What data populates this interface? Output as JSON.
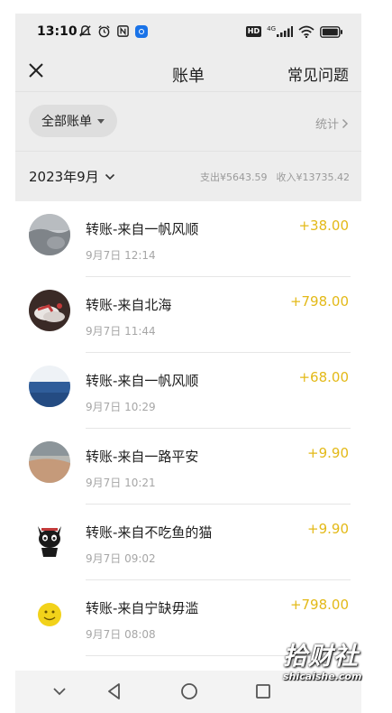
{
  "status_bar": {
    "time": "13:10",
    "left_icons": [
      "mute-icon",
      "alarm-icon",
      "nfc-icon",
      "app-notification-icon"
    ],
    "right_icons": [
      "hd-icon",
      "signal-icon",
      "wifi-icon",
      "battery-icon"
    ],
    "hd_label": "HD",
    "network_label": "4G"
  },
  "nav": {
    "title": "账单",
    "faq_label": "常见问题",
    "close_icon": "close-icon"
  },
  "filter": {
    "all_bills_label": "全部账单",
    "stats_label": "统计"
  },
  "month": {
    "label": "2023年9月",
    "expense": "支出¥5643.59",
    "income": "收入¥13735.42"
  },
  "transactions": [
    {
      "title": "转账-来自一帆风顺",
      "time": "9月7日 12:14",
      "amount": "+38.00",
      "avatar": "gray-landscape"
    },
    {
      "title": "转账-来自北海",
      "time": "9月7日 11:44",
      "amount": "+798.00",
      "avatar": "shoes-photo"
    },
    {
      "title": "转账-来自一帆风顺",
      "time": "9月7日 10:29",
      "amount": "+68.00",
      "avatar": "blue-sea"
    },
    {
      "title": "转账-来自一路平安",
      "time": "9月7日 10:21",
      "amount": "+9.90",
      "avatar": "beach"
    },
    {
      "title": "转账-来自不吃鱼的猫",
      "time": "9月7日 09:02",
      "amount": "+9.90",
      "avatar": "cartoon-cat"
    },
    {
      "title": "转账-来自宁缺毋滥",
      "time": "9月7日 08:08",
      "amount": "+798.00",
      "avatar": "smiley"
    }
  ],
  "colors": {
    "amount": "#e3b917",
    "background": "#ededed",
    "list_background": "#ffffff"
  },
  "watermark": {
    "chinese": "拾财社",
    "url": "shicaishe.com"
  }
}
